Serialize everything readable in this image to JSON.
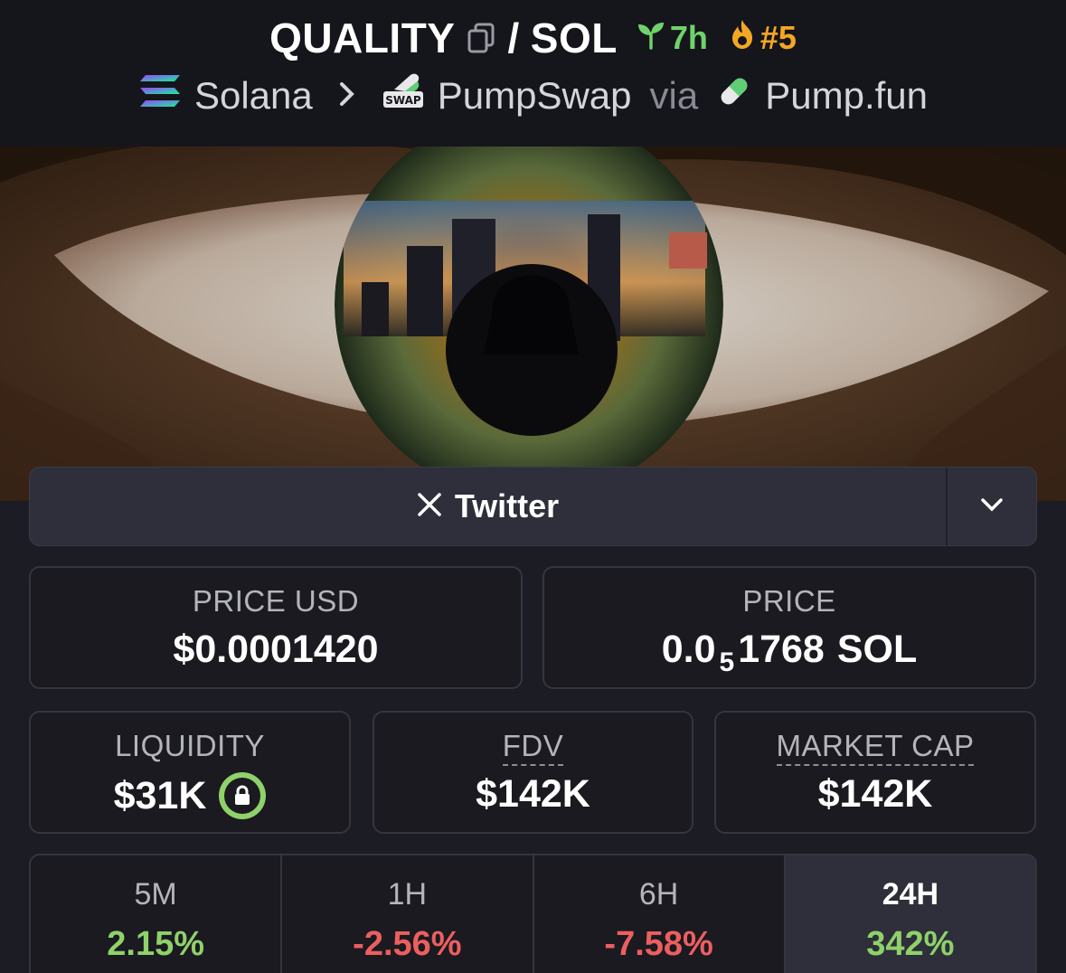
{
  "header": {
    "base_symbol": "QUALITY",
    "separator": "/",
    "quote_symbol": "SOL",
    "age": "7h",
    "trending_rank": "#5",
    "colors": {
      "age": "#6fd36b",
      "trending": "#f5a623"
    },
    "icons": {
      "copy": "copy-icon",
      "age": "seedling-icon",
      "trending": "flame-icon"
    }
  },
  "breadcrumb": {
    "chain": "Solana",
    "dex": "PumpSwap",
    "via": "via",
    "launchpad": "Pump.fun",
    "icons": {
      "chain": "solana-logo-icon",
      "separator": "chevron-right-icon",
      "dex": "pumpswap-logo-icon",
      "launchpad": "pill-icon"
    },
    "dex_logo_text": "SWAP"
  },
  "social": {
    "label": "Twitter",
    "icons": {
      "brand": "x-logo-icon",
      "toggle": "chevron-down-icon"
    }
  },
  "stats": {
    "price_usd": {
      "label": "PRICE USD",
      "value": "$0.0001420"
    },
    "price_native": {
      "label": "PRICE",
      "prefix": "0.0",
      "zeros": "5",
      "digits": "1768",
      "unit": "SOL"
    },
    "liquidity": {
      "label": "LIQUIDITY",
      "value": "$31K",
      "icon": "lock-icon",
      "lock_color": "#8fd16a"
    },
    "fdv": {
      "label": "FDV",
      "value": "$142K"
    },
    "market_cap": {
      "label": "MARKET CAP",
      "value": "$142K"
    }
  },
  "timeframes": [
    {
      "label": "5M",
      "change": "2.15%",
      "direction": "up"
    },
    {
      "label": "1H",
      "change": "-2.56%",
      "direction": "down"
    },
    {
      "label": "6H",
      "change": "-7.58%",
      "direction": "down"
    },
    {
      "label": "24H",
      "change": "342%",
      "direction": "up",
      "selected": true
    }
  ],
  "colors": {
    "positive": "#8fd16a",
    "negative": "#ec5f5f",
    "background": "#1c1c24"
  }
}
